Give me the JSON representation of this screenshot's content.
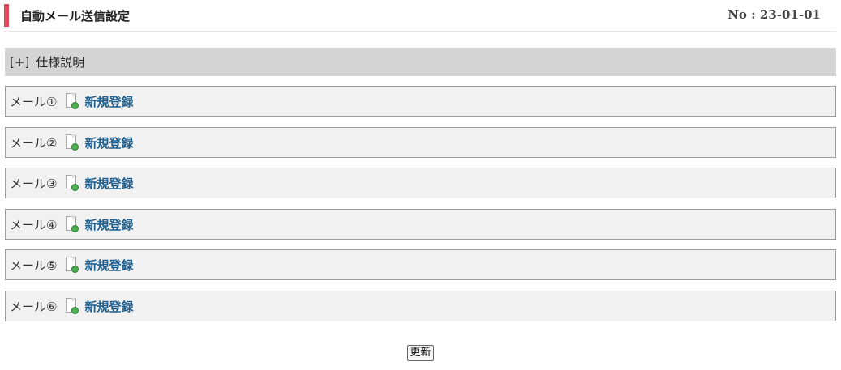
{
  "header": {
    "title": "自動メール送信設定",
    "screen_no": "No : 23-01-01",
    "accent_color": "#e0495a"
  },
  "spec": {
    "toggle": "[+]",
    "label": "仕様説明"
  },
  "mails": [
    {
      "label": "メール①",
      "link": "新規登録",
      "icon": "new-document-icon"
    },
    {
      "label": "メール②",
      "link": "新規登録",
      "icon": "new-document-icon"
    },
    {
      "label": "メール③",
      "link": "新規登録",
      "icon": "new-document-icon"
    },
    {
      "label": "メール④",
      "link": "新規登録",
      "icon": "new-document-icon"
    },
    {
      "label": "メール⑤",
      "link": "新規登録",
      "icon": "new-document-icon"
    },
    {
      "label": "メール⑥",
      "link": "新規登録",
      "icon": "new-document-icon"
    }
  ],
  "actions": {
    "update_label": "更新"
  }
}
